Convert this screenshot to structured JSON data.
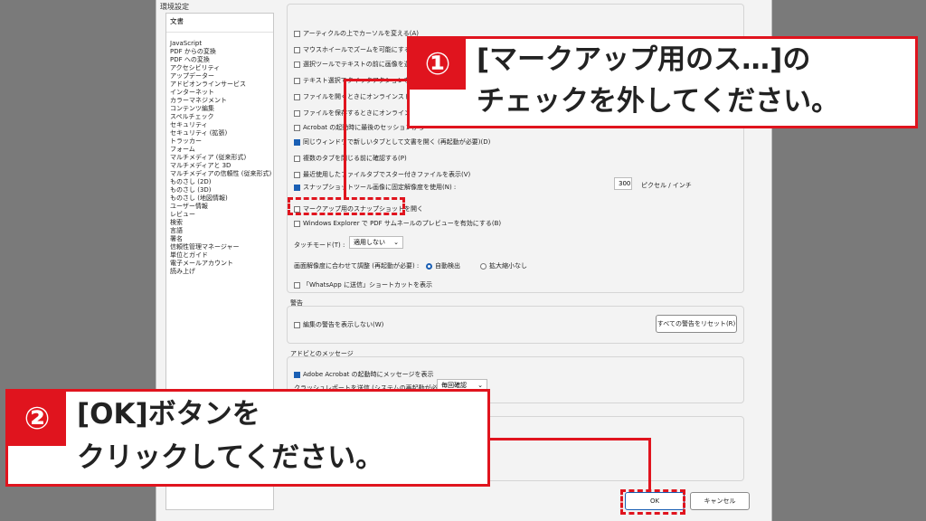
{
  "dialog": {
    "title": "環境設定",
    "categories_header": "文書",
    "categories": [
      "JavaScript",
      "PDF からの変換",
      "PDF への変換",
      "アクセシビリティ",
      "アップデーター",
      "アドビオンラインサービス",
      "インターネット",
      "カラーマネジメント",
      "コンテンツ編集",
      "スペルチェック",
      "セキュリティ",
      "セキュリティ (拡張)",
      "トラッカー",
      "フォーム",
      "マルチメディア (従来形式)",
      "マルチメディアと 3D",
      "マルチメディアの信頼性 (従来形式)",
      "ものさし (2D)",
      "ものさし (3D)",
      "ものさし (地図情報)",
      "ユーザー情報",
      "レビュー",
      "検索",
      "言語",
      "署名",
      "信頼性管理マネージャー",
      "単位とガイド",
      "電子メールアカウント",
      "読み上げ"
    ],
    "options": [
      {
        "label": "アーティクルの上でカーソルを変える(A)",
        "checked": false
      },
      {
        "label": "マウスホイールでズームを可能にする(Z)",
        "checked": false
      },
      {
        "label": "選択ツールでテキストの前に画像を選択",
        "checked": false
      },
      {
        "label": "テキスト選択でクイックアクションを表示",
        "checked": false
      },
      {
        "label": "ファイルを開くときにオンラインストレージ",
        "checked": false
      },
      {
        "label": "ファイルを保存するときにオンラインストレ",
        "checked": false
      },
      {
        "label": "Acrobat の起動時に最後のセッションから",
        "checked": false
      },
      {
        "label": "同じウィンドウで新しいタブとして文書を開く (再起動が必要)(D)",
        "checked": true
      },
      {
        "label": "複数のタブを閉じる前に確認する(P)",
        "checked": false
      },
      {
        "label": "最近使用したファイルタブでスター付きファイルを表示(V)",
        "checked": false
      },
      {
        "label": "スナップショットツール画像に固定解像度を使用(N) :",
        "checked": true
      },
      {
        "label": "マークアップ用のスナップショットを開く",
        "checked": false
      },
      {
        "label": "Windows Explorer で PDF サムネールのプレビューを有効にする(B)",
        "checked": false
      }
    ],
    "resolution_value": "300",
    "resolution_unit": "ピクセル / インチ",
    "touch_mode_label": "タッチモード(T) :",
    "touch_mode_value": "適用しない",
    "screen_res_label": "画面解像度に合わせて調整 (再起動が必要) :",
    "radio_auto": "自動検出",
    "radio_zoom": "拡大縮小なし",
    "whatsapp_label": "「WhatsApp に送信」ショートカットを表示",
    "warnings_title": "警告",
    "warnings_checkbox": "編集の警告を表示しない(W)",
    "reset_warnings_button": "すべての警告をリセット(R)",
    "adobe_msg_title": "アドビとのメッセージ",
    "adobe_msg_checkbox": "Adobe Acrobat の起動時にメッセージを表示",
    "crash_label": "クラッシュレポートを送信 (システムの再起動が必要) :",
    "crash_value": "毎回確認",
    "ok_button": "OK",
    "cancel_button": "キャンセル"
  },
  "callouts": {
    "step1_badge": "①",
    "step1_line1": "[マークアップ用のス…]の",
    "step1_line2": "チェックを外してください。",
    "step2_badge": "②",
    "step2_line1": "[OK]ボタンを",
    "step2_line2": "クリックしてください。"
  },
  "colors": {
    "accent_red": "#e0141e",
    "checkbox_blue": "#1a5fb4"
  }
}
